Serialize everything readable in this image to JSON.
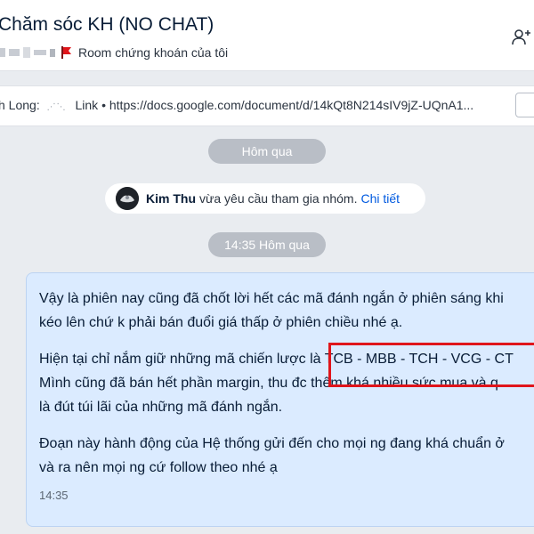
{
  "header": {
    "title": "Chăm sóc KH (NO CHAT)",
    "room_label": "Room chứng khoán của tôi",
    "tag_color": "#e0151b"
  },
  "pinned": {
    "text_prefix": "h Long:",
    "link_label": "Link",
    "separator": "•",
    "url": "https://docs.google.com/document/d/14kQt8N214sIV9jZ-UQnA1..."
  },
  "chat": {
    "date_chip": "Hôm qua",
    "notice": {
      "name": "Kim Thu",
      "message": "vừa yêu cầu tham gia nhóm.",
      "link": "Chi tiết"
    },
    "time_chip": "14:35 Hôm qua",
    "message": {
      "lines": [
        "Vậy là phiên nay cũng đã chốt lời hết các mã đánh ngắn ở phiên sáng khi",
        "kéo lên chứ k phải bán đuổi giá thấp ở phiên chiều nhé ạ.",
        "Hiện tại chỉ nắm giữ những mã chiến lược là TCB - MBB - TCH - VCG - CT",
        "Mình cũng đã bán hết phần margin, thu đc thêm khá nhiều sức mua và q",
        "là đút túi lãi của những mã đánh ngắn.",
        "Đoạn này hành động của Hệ thống gửi đến cho mọi ng đang khá chuẩn ở",
        "và ra nên mọi ng cứ follow theo nhé ạ"
      ],
      "time": "14:35"
    }
  },
  "colors": {
    "bubble": "#dbebff",
    "chip": "#b9bec6",
    "link": "#005ae0",
    "highlight": "#e0151b"
  }
}
